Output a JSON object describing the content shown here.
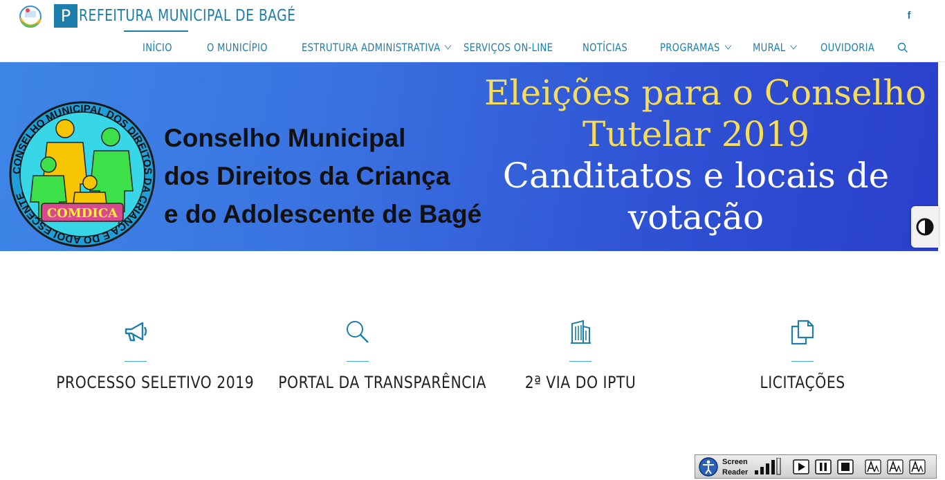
{
  "header": {
    "title_initial": "P",
    "title_rest": "REFEITURA MUNICIPAL DE BAGÉ",
    "facebook_glyph": "f"
  },
  "nav": {
    "items": [
      {
        "label": "INÍCIO",
        "has_submenu": false
      },
      {
        "label": "O MUNICÍPIO",
        "has_submenu": false
      },
      {
        "label": "ESTRUTURA ADMINISTRATIVA",
        "has_submenu": true
      },
      {
        "label": "SERVIÇOS ON-LINE",
        "has_submenu": false
      },
      {
        "label": "NOTÍCIAS",
        "has_submenu": false
      },
      {
        "label": "PROGRAMAS",
        "has_submenu": true
      },
      {
        "label": "MURAL",
        "has_submenu": true
      },
      {
        "label": "OUVIDORIA",
        "has_submenu": false
      }
    ],
    "search_icon": "search-icon"
  },
  "banner": {
    "seal_text": "CONSELHO MUNICIPAL DOS DIREITOS DA CRIANÇA E DO ADOLESCENTE",
    "seal_badge": "COMDICA",
    "council_lines": [
      "Conselho Municipal",
      "dos Direitos da Criança",
      "e do Adolescente de Bagé"
    ],
    "headline_yellow": [
      "Eleições para o Conselho",
      "Tutelar 2019"
    ],
    "headline_white": [
      "Canditatos e locais de",
      "votação"
    ]
  },
  "quick_links": [
    {
      "label": "PROCESSO SELETIVO 2019",
      "icon": "megaphone-icon"
    },
    {
      "label": "PORTAL DA TRANSPARÊNCIA",
      "icon": "magnifier-icon"
    },
    {
      "label": "2ª VIA DO IPTU",
      "icon": "building-icon"
    },
    {
      "label": "LICITAÇÕES",
      "icon": "documents-icon"
    }
  ],
  "screen_reader": {
    "line1": "Screen",
    "line2": "Reader"
  },
  "colors": {
    "brand": "#1b7eab",
    "banner_start": "#3d86e6",
    "banner_end": "#2a3fcb",
    "headline_yellow": "#f5dc5a"
  }
}
